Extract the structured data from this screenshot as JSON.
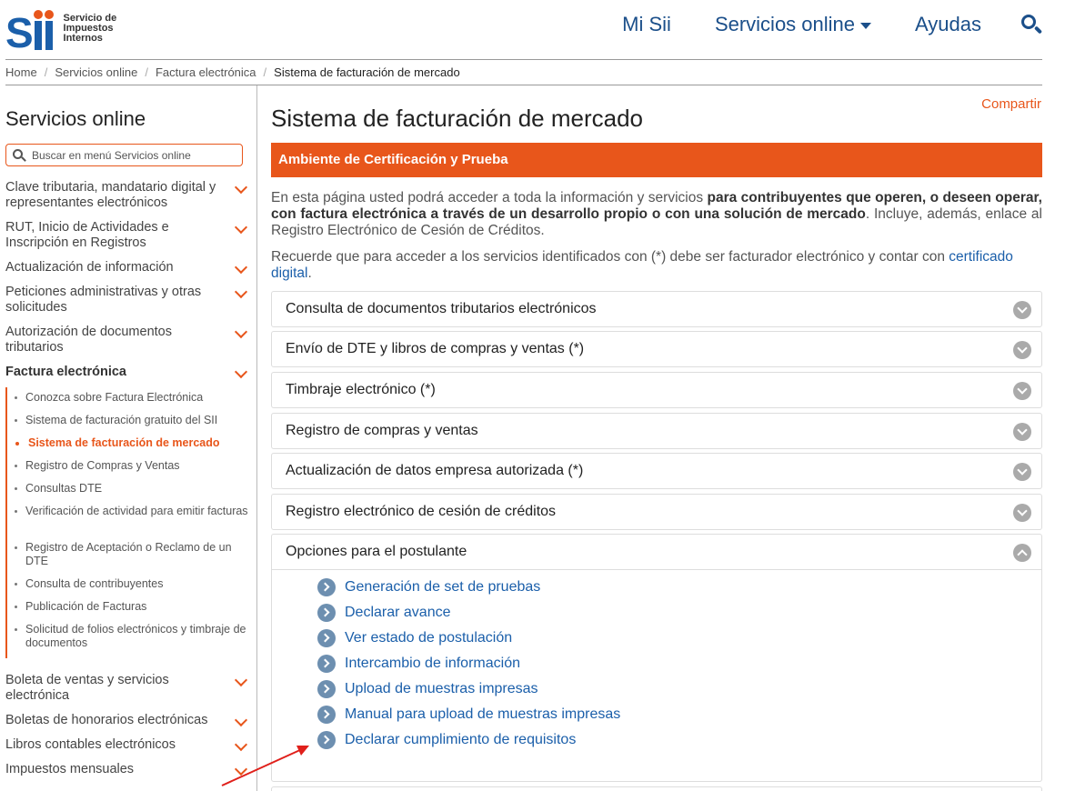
{
  "header": {
    "logo_lines": [
      "Servicio de",
      "Impuestos",
      "Internos"
    ],
    "nav": [
      "Mi Sii",
      "Servicios online",
      "Ayudas"
    ],
    "accent_blue": "#1b4f8a",
    "accent_orange": "#e8561b"
  },
  "breadcrumb": [
    "Home",
    "Servicios online",
    "Factura electrónica",
    "Sistema de facturación de mercado"
  ],
  "sidebar": {
    "title": "Servicios online",
    "search_placeholder": "Buscar en menú Servicios online",
    "items": [
      "Clave tributaria, mandatario digital y representantes electrónicos",
      "RUT, Inicio de Actividades e Inscripción en Registros",
      "Actualización de información",
      "Peticiones administrativas y otras solicitudes",
      "Autorización de documentos tributarios",
      "Factura electrónica",
      "Boleta de ventas y servicios electrónica",
      "Boletas de honorarios electrónicas",
      "Libros contables electrónicos",
      "Impuestos mensuales"
    ],
    "subitems": [
      "Conozca sobre Factura Electrónica",
      "Sistema de facturación gratuito del SII",
      "Sistema de facturación de mercado",
      "Registro de Compras y Ventas",
      "Consultas DTE",
      "Verificación de actividad para emitir facturas",
      "Registro de Aceptación o Reclamo de un DTE",
      "Consulta de contribuyentes",
      "Publicación de Facturas",
      "Solicitud de folios electrónicos y timbraje de documentos"
    ]
  },
  "main": {
    "share": "Compartir",
    "title": "Sistema de facturación de mercado",
    "banner": "Ambiente de Certificación y Prueba",
    "intro_a": "En esta página usted podrá acceder a toda la información y servicios ",
    "intro_b": "para contribuyentes que operen, o deseen operar, con factura electrónica a través de un desarrollo propio o con una solución de mercado",
    "intro_c": ". Incluye, además, enlace al Registro Electrónico de Cesión de Créditos.",
    "intro2_a": "Recuerde que para acceder a los servicios identificados con (*) debe ser facturador electrónico y contar con ",
    "intro2_link": "certificado digital",
    "intro2_b": ".",
    "accordions": [
      "Consulta de documentos tributarios electrónicos",
      "Envío de DTE y libros de compras y ventas (*)",
      "Timbraje electrónico (*)",
      "Registro de compras y ventas",
      "Actualización de datos empresa autorizada (*)",
      "Registro electrónico de cesión de créditos",
      "Opciones para el postulante"
    ],
    "options": [
      "Generación de set de pruebas",
      "Declarar avance",
      "Ver estado de postulación",
      "Intercambio de información",
      "Upload de muestras impresas",
      "Manual para upload de muestras impresas",
      "Declarar cumplimiento de requisitos"
    ]
  }
}
